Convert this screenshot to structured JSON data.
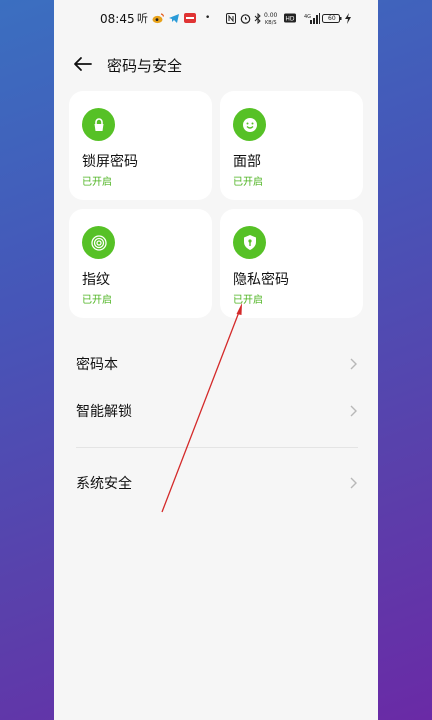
{
  "status_bar": {
    "time": "08:45",
    "app_text": "听",
    "speed_value": "0.00",
    "speed_unit": "KB/S",
    "network": "4G",
    "battery": "60"
  },
  "header": {
    "title": "密码与安全"
  },
  "cards": [
    {
      "label": "锁屏密码",
      "status": "已开启",
      "icon": "lock-icon"
    },
    {
      "label": "面部",
      "status": "已开启",
      "icon": "face-icon"
    },
    {
      "label": "指纹",
      "status": "已开启",
      "icon": "fingerprint-icon"
    },
    {
      "label": "隐私密码",
      "status": "已开启",
      "icon": "shield-key-icon"
    }
  ],
  "list": [
    {
      "label": "密码本"
    },
    {
      "label": "智能解锁"
    },
    {
      "label": "系统安全"
    }
  ],
  "colors": {
    "accent_green": "#56c126",
    "status_green": "#4fb423",
    "annotation_red": "#d42a2a"
  }
}
